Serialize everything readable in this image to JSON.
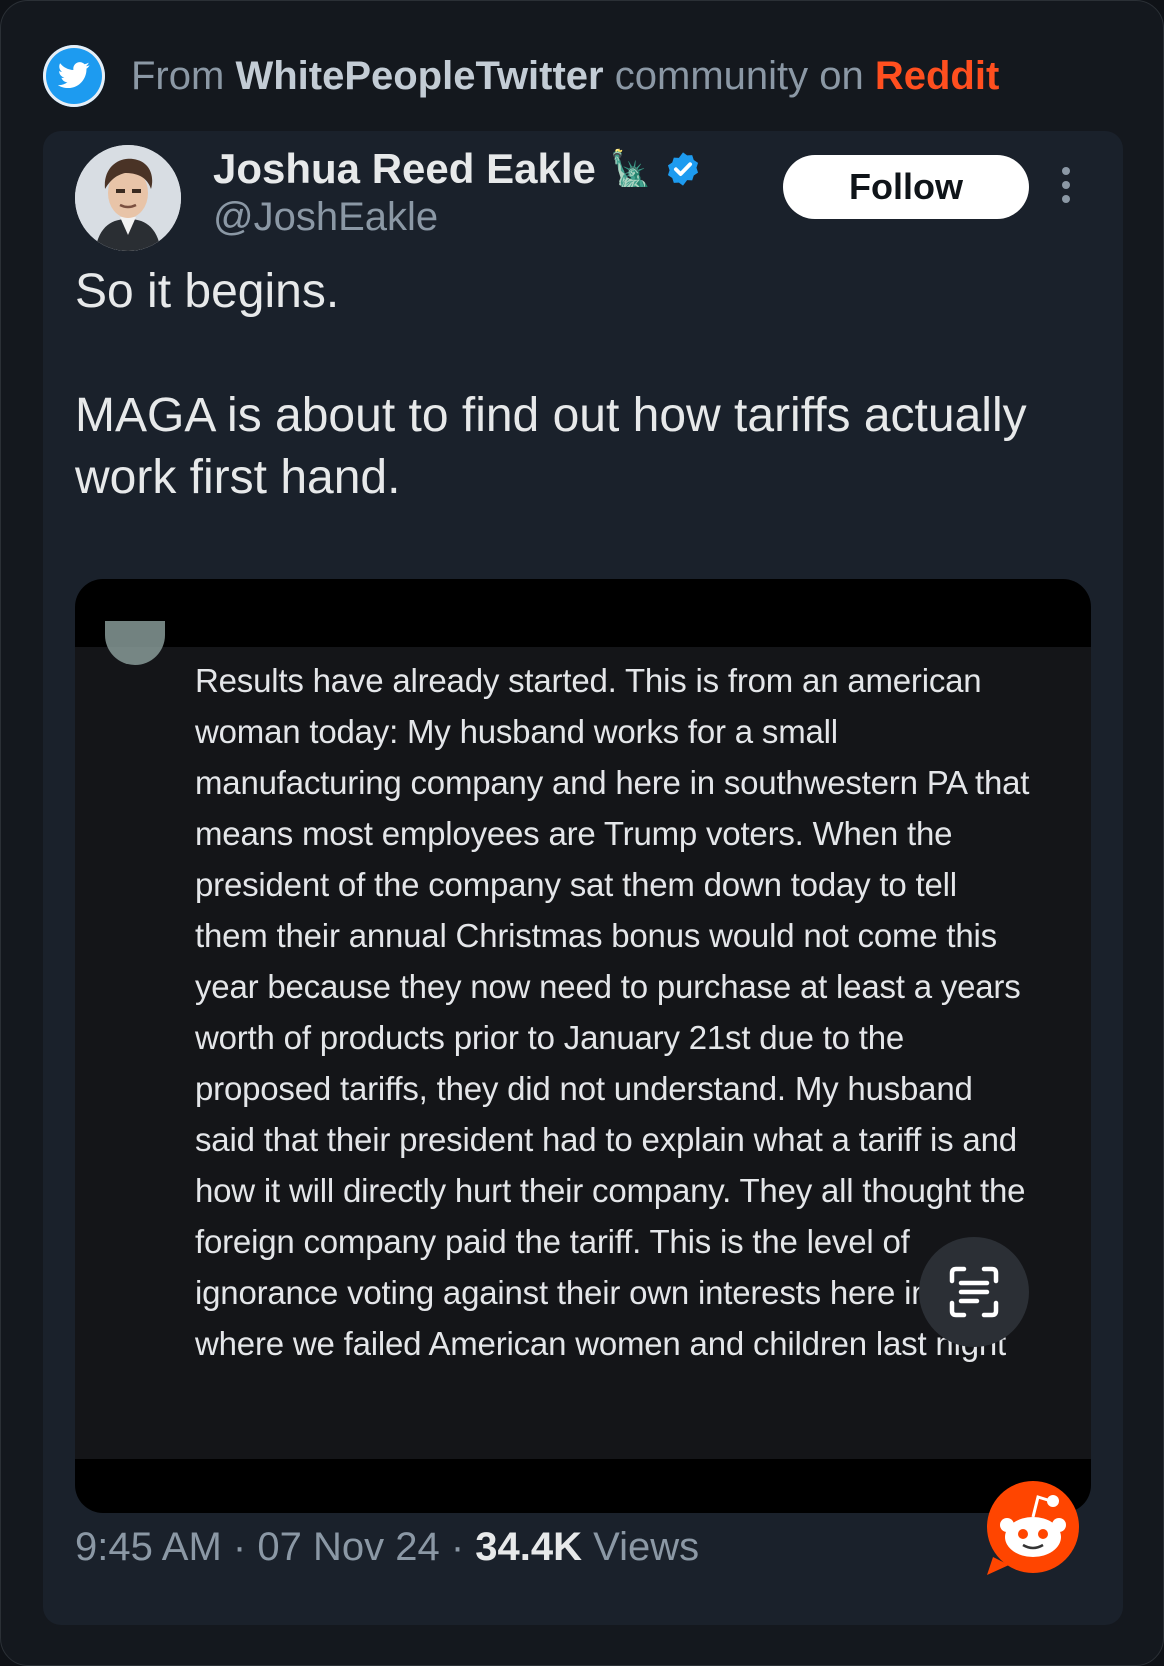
{
  "header": {
    "from_label": "From",
    "community": "WhitePeopleTwitter",
    "community_suffix": "community on",
    "platform": "Reddit",
    "platform_color": "#ff4f1f"
  },
  "tweet": {
    "author_name": "Joshua Reed Eakle",
    "name_emoji": "🗽",
    "handle": "@JoshEakle",
    "follow_label": "Follow",
    "text_line1": "So it begins.",
    "text_line2": "MAGA is about to find out how tariffs actually work first hand.",
    "embedded_text": "Results have already started.  This is from an american woman today: My husband works for a small manufacturing company and here in southwestern PA that means most employees are Trump voters. When the president of the company sat them down today to tell them their annual Christmas bonus would not come this year because they now need to purchase at least a years worth of products prior to January 21st due to the proposed tariffs, they did not understand. My husband said that their president had to explain what a tariff is and how it will directly hurt their company. They all thought the foreign company paid the tariff. This is the level of ignorance voting against their own interests here in PA, where we failed American women and children last night",
    "time": "9:45 AM",
    "date": "07 Nov 24",
    "views_count": "34.4K",
    "views_label": "Views",
    "separator": "·"
  },
  "icons": {
    "platform_badge": "twitter-bird-icon",
    "verified": "verified-badge-icon",
    "more": "more-vertical-icon",
    "scan": "text-scan-icon",
    "reddit": "reddit-snoo-icon"
  }
}
